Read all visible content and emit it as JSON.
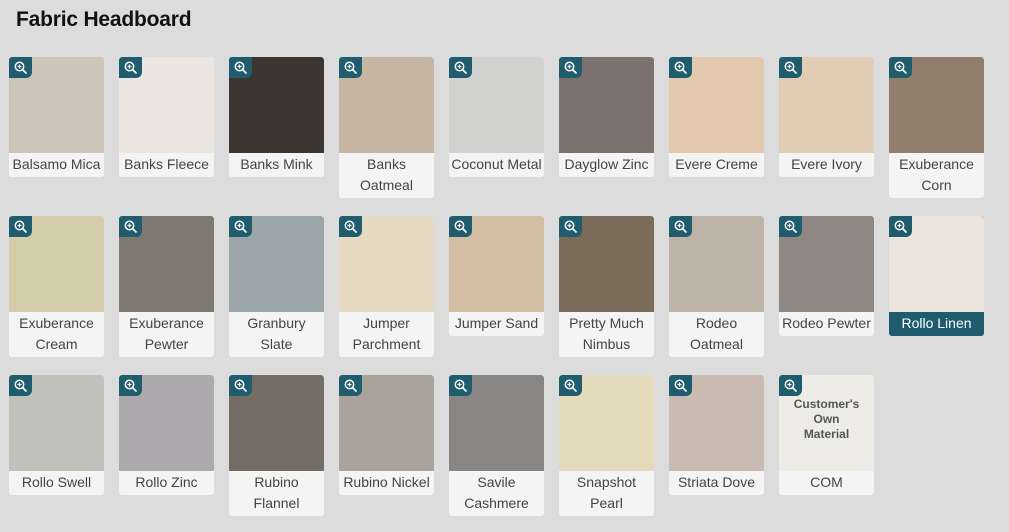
{
  "header": {
    "title": "Fabric Headboard"
  },
  "icons": {
    "zoom": "zoom-in-icon"
  },
  "colors": {
    "accent": "#1e5c6e"
  },
  "rows": [
    {
      "items": [
        {
          "label": "Balsamo Mica",
          "color": "#cdc5b9"
        },
        {
          "label": "Banks Fleece",
          "color": "#ebe7e0"
        },
        {
          "label": "Banks Mink",
          "color": "#3d3531"
        },
        {
          "label": "Banks Oatmeal",
          "color": "#c5b5a1"
        },
        {
          "label": "Coconut Metal",
          "color": "#d2d2d0"
        },
        {
          "label": "Dayglow Zinc",
          "color": "#7c716c"
        },
        {
          "label": "Evere Creme",
          "color": "#e3c9ad"
        },
        {
          "label": "Evere Ivory",
          "color": "#e1ccb5"
        },
        {
          "label": "Exuberance Corn",
          "color": "#917f6c"
        }
      ]
    },
    {
      "items": [
        {
          "label": "Exuberance Cream",
          "color": "#d3cdaa"
        },
        {
          "label": "Exuberance Pewter",
          "color": "#7d7870"
        },
        {
          "label": "Granbury Slate",
          "color": "#9aa6a8"
        },
        {
          "label": "Jumper Parchment",
          "color": "#e6d9c2"
        },
        {
          "label": "Jumper Sand",
          "color": "#d3bea4"
        },
        {
          "label": "Pretty Much Nimbus",
          "color": "#7b6c5a"
        },
        {
          "label": "Rodeo Oatmeal",
          "color": "#bdb3a6"
        },
        {
          "label": "Rodeo Pewter",
          "color": "#8f8781"
        },
        {
          "label": "Rollo Linen",
          "color": "#ece5de",
          "selected": true
        }
      ]
    },
    {
      "items": [
        {
          "label": "Rollo Swell",
          "color": "#c1c1bc"
        },
        {
          "label": "Rollo Zinc",
          "color": "#adaaae"
        },
        {
          "label": "Rubino Flannel",
          "color": "#756c63"
        },
        {
          "label": "Rubino Nickel",
          "color": "#a9a39b"
        },
        {
          "label": "Savile Cashmere",
          "color": "#878684"
        },
        {
          "label": "Snapshot Pearl",
          "color": "#e4dbbd"
        },
        {
          "label": "Striata Dove",
          "color": "#c9bbb2"
        },
        {
          "label": "COM",
          "color": "#edece6",
          "image_text": "Customer's Own Material"
        }
      ]
    }
  ]
}
